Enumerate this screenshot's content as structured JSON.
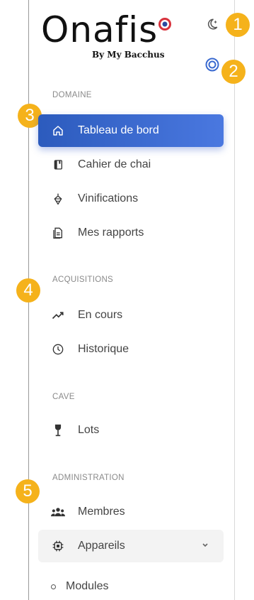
{
  "brand": {
    "name": "Onafis",
    "subtitle": "By My Bacchus"
  },
  "badges": [
    "1",
    "2",
    "3",
    "4",
    "5"
  ],
  "sections": {
    "domaine": "DOMAINE",
    "acquisitions": "ACQUISITIONS",
    "cave": "CAVE",
    "administration": "ADMINISTRATION"
  },
  "nav": {
    "tableau": "Tableau de bord",
    "cahier": "Cahier de chai",
    "vinifications": "Vinifications",
    "rapports": "Mes rapports",
    "en_cours": "En cours",
    "historique": "Historique",
    "lots": "Lots",
    "membres": "Membres",
    "appareils": "Appareils",
    "modules": "Modules"
  },
  "colors": {
    "accent": "#2c5bbd",
    "badge": "#f5b21b"
  },
  "icons": [
    "moon-icon",
    "target-icon",
    "home-icon",
    "notebook-icon",
    "grape-icon",
    "report-icon",
    "trend-icon",
    "clock-icon",
    "wine-glass-icon",
    "people-icon",
    "chip-icon",
    "chevron-down-icon"
  ]
}
